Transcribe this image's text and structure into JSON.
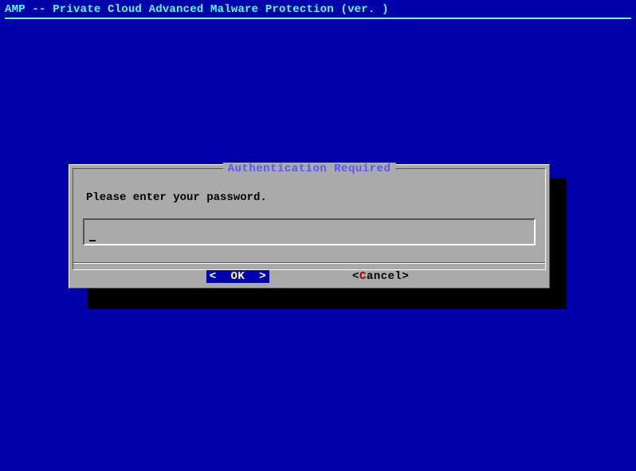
{
  "header": {
    "title": "AMP -- Private Cloud Advanced Malware Protection (ver. )"
  },
  "dialog": {
    "title": "Authentication Required",
    "prompt": "Please enter your password.",
    "password_value": "",
    "ok_bracket_l": "<",
    "ok_bracket_r": ">",
    "ok_hotkey": "O",
    "ok_rest": "K",
    "cancel_bracket_l": "<",
    "cancel_bracket_r": ">",
    "cancel_hotkey": "C",
    "cancel_rest": "ancel"
  }
}
